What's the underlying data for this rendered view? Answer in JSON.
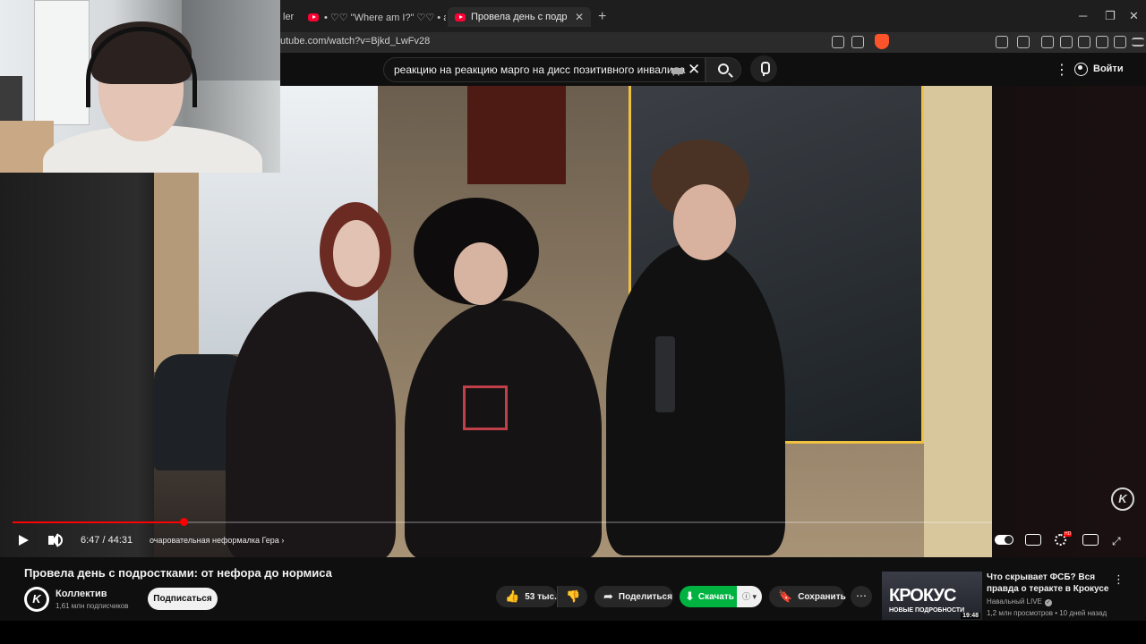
{
  "browser": {
    "tabs": [
      {
        "label": "ler"
      },
      {
        "label": "• ♡♡ \"Where am I?\" ♡♡ • a dreamcore"
      },
      {
        "label": "Провела день с подростками: от"
      }
    ],
    "new_tab": "+",
    "url": "utube.com/watch?v=Bjkd_LwFv28",
    "window_controls": [
      "─",
      "❐",
      "✕"
    ]
  },
  "header": {
    "search_query": "реакцию на реакцию марго на дисс позитивного инвалида",
    "clear": "✕",
    "menu": "⋮",
    "signin": "Войти"
  },
  "player": {
    "current_time": "6:47",
    "duration": "44:31",
    "time_text": "6:47 / 44:31",
    "chapter": "очаровательная неформалка Гера",
    "chapter_arrow": "›",
    "watermark": "K",
    "progress_fraction": 0.175,
    "buffered_fraction": 0.167,
    "progress_color": "#ff0000",
    "fullscreen": "⤢"
  },
  "video": {
    "title": "Провела день с подростками: от нефора до нормиса",
    "channel": "Коллектив",
    "subscribers": "1,61 млн подписчиков",
    "subscribe_label": "Подписаться",
    "likes": "53 тыс.",
    "share_label": "Поделиться",
    "download_label": "Скачать",
    "save_label": "Сохранить",
    "more": "⋯",
    "download_color": "#00b341"
  },
  "recommended": {
    "thumb_title_big": "КРОКУС",
    "thumb_title_small": "НОВЫЕ ПОДРОБНОСТИ",
    "duration": "19:48",
    "title": "Что скрывает ФСБ? Вся правда о теракте в Крокусе",
    "channel": "Навальный LIVE",
    "meta": "1,2 млн просмотров • 10 дней назад",
    "menu": "⋮"
  }
}
